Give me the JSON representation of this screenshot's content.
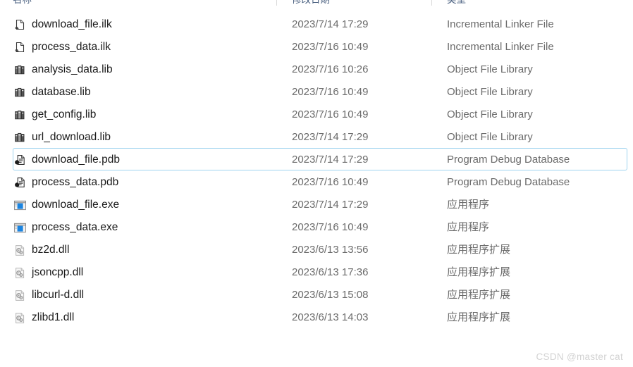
{
  "window": {
    "kind": "file-explorer-list",
    "watermark": "CSDN @master cat"
  },
  "columns": {
    "name": "名称",
    "date": "修改日期",
    "type": "类型"
  },
  "colors": {
    "selection_border": "#9fd4ef",
    "header_text": "#4a6080",
    "primary_text": "#1a1a1a",
    "secondary_text": "#6b6b6b",
    "watermark": "#d2d2d2",
    "divider": "#d8d8d8"
  },
  "files": [
    {
      "name": "download_file.ilk",
      "date": "2023/7/14 17:29",
      "type": "Incremental Linker File",
      "icon": "ilk-file-icon",
      "selected": false
    },
    {
      "name": "process_data.ilk",
      "date": "2023/7/16 10:49",
      "type": "Incremental Linker File",
      "icon": "ilk-file-icon",
      "selected": false
    },
    {
      "name": "analysis_data.lib",
      "date": "2023/7/16 10:26",
      "type": "Object File Library",
      "icon": "lib-file-icon",
      "selected": false
    },
    {
      "name": "database.lib",
      "date": "2023/7/16 10:49",
      "type": "Object File Library",
      "icon": "lib-file-icon",
      "selected": false
    },
    {
      "name": "get_config.lib",
      "date": "2023/7/16 10:49",
      "type": "Object File Library",
      "icon": "lib-file-icon",
      "selected": false
    },
    {
      "name": "url_download.lib",
      "date": "2023/7/14 17:29",
      "type": "Object File Library",
      "icon": "lib-file-icon",
      "selected": false
    },
    {
      "name": "download_file.pdb",
      "date": "2023/7/14 17:29",
      "type": "Program Debug Database",
      "icon": "pdb-file-icon",
      "selected": true
    },
    {
      "name": "process_data.pdb",
      "date": "2023/7/16 10:49",
      "type": "Program Debug Database",
      "icon": "pdb-file-icon",
      "selected": false
    },
    {
      "name": "download_file.exe",
      "date": "2023/7/14 17:29",
      "type": "应用程序",
      "icon": "exe-application-icon",
      "selected": false
    },
    {
      "name": "process_data.exe",
      "date": "2023/7/16 10:49",
      "type": "应用程序",
      "icon": "exe-application-icon",
      "selected": false
    },
    {
      "name": "bz2d.dll",
      "date": "2023/6/13 13:56",
      "type": "应用程序扩展",
      "icon": "dll-file-icon",
      "selected": false
    },
    {
      "name": "jsoncpp.dll",
      "date": "2023/6/13 17:36",
      "type": "应用程序扩展",
      "icon": "dll-file-icon",
      "selected": false
    },
    {
      "name": "libcurl-d.dll",
      "date": "2023/6/13 15:08",
      "type": "应用程序扩展",
      "icon": "dll-file-icon",
      "selected": false
    },
    {
      "name": "zlibd1.dll",
      "date": "2023/6/13 14:03",
      "type": "应用程序扩展",
      "icon": "dll-file-icon",
      "selected": false
    }
  ]
}
